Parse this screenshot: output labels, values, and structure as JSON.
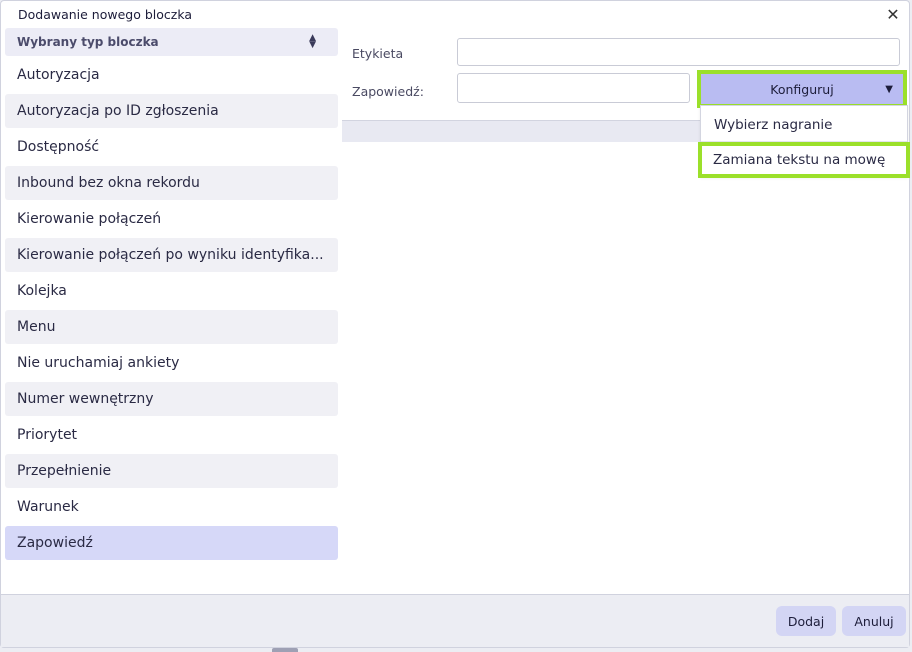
{
  "dialog": {
    "title": "Dodawanie nowego bloczka",
    "close_symbol": "✕"
  },
  "block_type": {
    "header_label": "Wybrany typ bloczka",
    "sort_icon": "sort-updown-icon",
    "items": [
      {
        "label": "Autoryzacja"
      },
      {
        "label": "Autoryzacja po ID zgłoszenia"
      },
      {
        "label": "Dostępność"
      },
      {
        "label": "Inbound bez okna rekordu"
      },
      {
        "label": "Kierowanie połączeń"
      },
      {
        "label": "Kierowanie połączeń po wyniku identyfika..."
      },
      {
        "label": "Kolejka"
      },
      {
        "label": "Menu"
      },
      {
        "label": "Nie uruchamiaj ankiety"
      },
      {
        "label": "Numer wewnętrzny"
      },
      {
        "label": "Priorytet"
      },
      {
        "label": "Przepełnienie"
      },
      {
        "label": "Warunek"
      },
      {
        "label": "Zapowiedź"
      }
    ],
    "selected": "Zapowiedź"
  },
  "form": {
    "label_field": {
      "label": "Etykieta",
      "value": ""
    },
    "announcement_field": {
      "label": "Zapowiedź:",
      "value": ""
    },
    "configure_button": {
      "label": "Konfiguruj"
    },
    "configure_menu": [
      {
        "label": "Wybierz nagranie"
      },
      {
        "label": "Zamiana tekstu na mowę"
      }
    ]
  },
  "footer": {
    "add_label": "Dodaj",
    "cancel_label": "Anuluj"
  },
  "colors": {
    "accent": "#b9bcf2",
    "selected_item": "#d6d8f8",
    "highlight_outline": "#9be02a",
    "footer_bg": "#ecedf3"
  }
}
